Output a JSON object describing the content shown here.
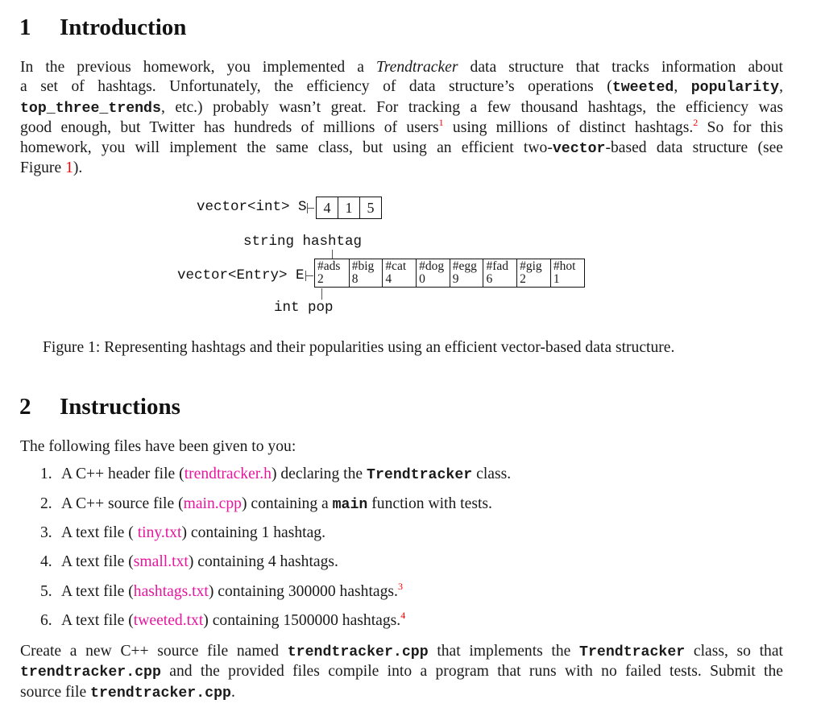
{
  "section1": {
    "number": "1",
    "title": "Introduction",
    "paragraph": {
      "l1_a": "In the previous homework, you implemented a ",
      "l1_em": "Trendtracker",
      "l1_b": " data structure that tracks information about",
      "l2_a": "a set of hashtags.  Unfortunately, the efficiency of data structure’s operations (",
      "l2_code1": "tweeted",
      "l2_b": ", ",
      "l2_code2": "popularity",
      "l2_c": ",",
      "l3_code": "top_three_trends",
      "l3_b": ", etc.)  probably wasn’t great.  For tracking a few thousand hashtags, the efficiency was",
      "l4_a": "good enough, but Twitter has hundreds of millions of users",
      "l4_fn1": "1",
      "l4_b": " using millions of distinct hashtags.",
      "l4_fn2": "2",
      "l4_c": "  So for this",
      "l5_a": "homework, you will implement the same class, but using an efficient two-",
      "l5_code": "vector",
      "l5_b": "-based data structure (see",
      "l6_a": "Figure ",
      "l6_ref": "1",
      "l6_b": ")."
    }
  },
  "figure": {
    "s_label": "vector<int> S",
    "s_values": [
      "4",
      "1",
      "5"
    ],
    "hashtag_label": "string hashtag",
    "e_label": "vector<Entry> E",
    "entries": [
      {
        "hashtag": "#ads",
        "pop": "2"
      },
      {
        "hashtag": "#big",
        "pop": "8"
      },
      {
        "hashtag": "#cat",
        "pop": "4"
      },
      {
        "hashtag": "#dog",
        "pop": "0"
      },
      {
        "hashtag": "#egg",
        "pop": "9"
      },
      {
        "hashtag": "#fad",
        "pop": "6"
      },
      {
        "hashtag": "#gig",
        "pop": "2"
      },
      {
        "hashtag": "#hot",
        "pop": "1"
      }
    ],
    "pop_label": "int pop",
    "caption": "Figure 1: Representing hashtags and their popularities using an efficient vector-based data structure."
  },
  "section2": {
    "number": "2",
    "title": "Instructions",
    "intro": "The following files have been given to you:",
    "items": [
      {
        "marker": "1.",
        "a": "A C++ header file (",
        "link": "trendtracker.h",
        "b": ") declaring the ",
        "code": "Trendtracker",
        "c": " class."
      },
      {
        "marker": "2.",
        "a": "A C++ source file (",
        "link": "main.cpp",
        "b": ") containing a ",
        "code": "main",
        "c": " function with tests."
      },
      {
        "marker": "3.",
        "a": "A text file ( ",
        "link": "tiny.txt",
        "b": ") containing 1 hashtag.",
        "code": "",
        "c": ""
      },
      {
        "marker": "4.",
        "a": "A text file (",
        "link": "small.txt",
        "b": ") containing 4 hashtags.",
        "code": "",
        "c": ""
      },
      {
        "marker": "5.",
        "a": "A text file (",
        "link": "hashtags.txt",
        "b": ") containing 300000 hashtags.",
        "fn": "3"
      },
      {
        "marker": "6.",
        "a": "A text file (",
        "link": "tweeted.txt",
        "b": ") containing 1500000 hashtags.",
        "fn": "4"
      }
    ],
    "closing": {
      "l1_a": "Create a new C++ source file named ",
      "l1_code1": "trendtracker.cpp",
      "l1_b": " that implements the ",
      "l1_code2": "Trendtracker",
      "l1_c": " class, so that",
      "l2_code": "trendtracker.cpp",
      "l2_b": " and the provided files compile into a program that runs with no failed tests.  Submit the",
      "l3_a": "source file ",
      "l3_code": "trendtracker.cpp",
      "l3_b": "."
    }
  },
  "colors": {
    "link": "#e6169e",
    "reference": "#ff0000"
  }
}
